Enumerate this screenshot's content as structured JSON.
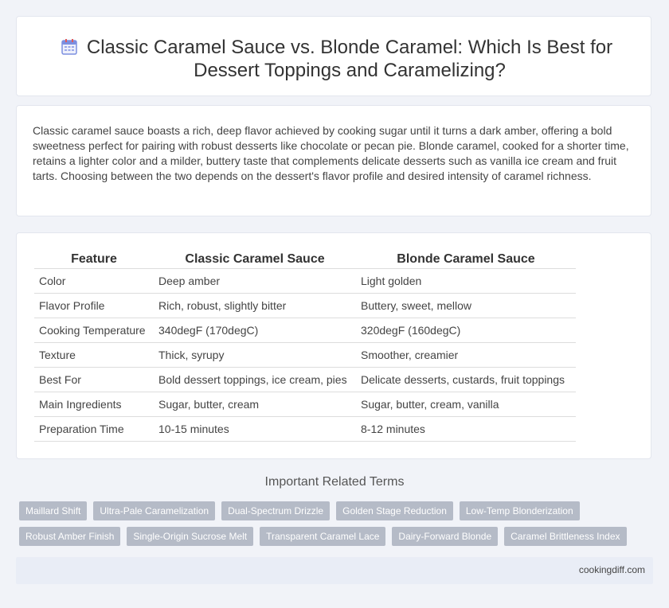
{
  "header": {
    "title": "Classic Caramel Sauce vs. Blonde Caramel: Which Is Best for Dessert Toppings and Caramelizing?",
    "icon": "calendar-icon"
  },
  "intro": {
    "text": "Classic caramel sauce boasts a rich, deep flavor achieved by cooking sugar until it turns a dark amber, offering a bold sweetness perfect for pairing with robust desserts like chocolate or pecan pie. Blonde caramel, cooked for a shorter time, retains a lighter color and a milder, buttery taste that complements delicate desserts such as vanilla ice cream and fruit tarts. Choosing between the two depends on the dessert's flavor profile and desired intensity of caramel richness."
  },
  "table": {
    "headers": [
      "Feature",
      "Classic Caramel Sauce",
      "Blonde Caramel Sauce"
    ],
    "rows": [
      [
        "Color",
        "Deep amber",
        "Light golden"
      ],
      [
        "Flavor Profile",
        "Rich, robust, slightly bitter",
        "Buttery, sweet, mellow"
      ],
      [
        "Cooking Temperature",
        "340degF (170degC)",
        "320degF (160degC)"
      ],
      [
        "Texture",
        "Thick, syrupy",
        "Smoother, creamier"
      ],
      [
        "Best For",
        "Bold dessert toppings, ice cream, pies",
        "Delicate desserts, custards, fruit toppings"
      ],
      [
        "Main Ingredients",
        "Sugar, butter, cream",
        "Sugar, butter, cream, vanilla"
      ],
      [
        "Preparation Time",
        "10-15 minutes",
        "8-12 minutes"
      ]
    ]
  },
  "related": {
    "title": "Important Related Terms",
    "row1": [
      "Maillard Shift",
      "Ultra-Pale Caramelization",
      "Dual-Spectrum Drizzle",
      "Golden Stage Reduction",
      "Low-Temp Blonderization"
    ],
    "row2": [
      "Robust Amber Finish",
      "Single-Origin Sucrose Melt",
      "Transparent Caramel Lace",
      "Dairy-Forward Blonde",
      "Caramel Brittleness Index"
    ]
  },
  "footer": {
    "site": "cookingdiff.com"
  },
  "colors": {
    "background": "#f1f3f8",
    "tag": "#b5bbc7",
    "icon_accent": "#7b8fe0"
  }
}
